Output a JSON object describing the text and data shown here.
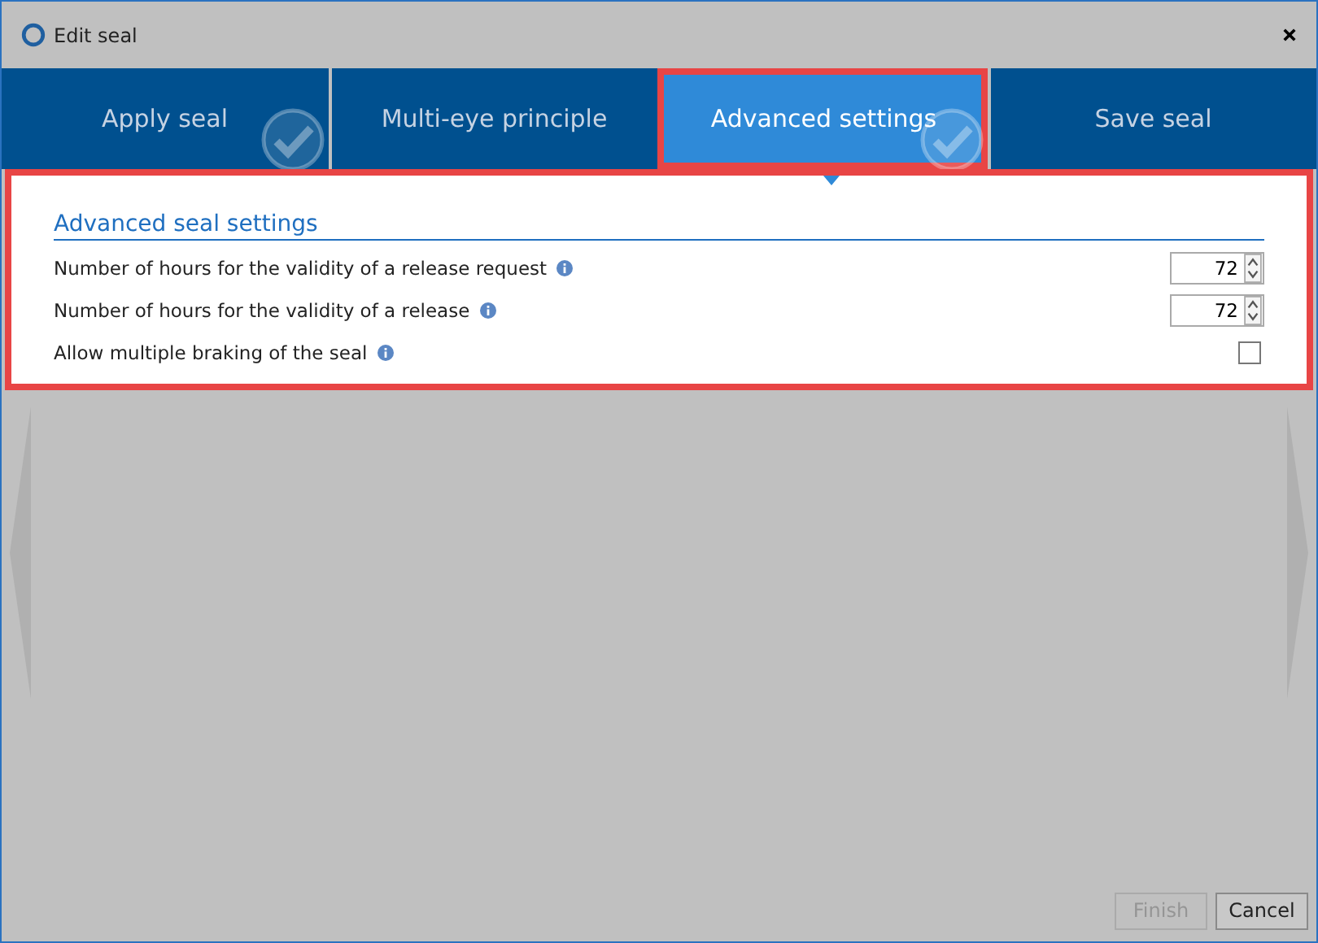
{
  "window": {
    "title": "Edit seal"
  },
  "tabs": [
    {
      "label": "Apply seal",
      "selected": false,
      "done": true
    },
    {
      "label": "Multi-eye principle",
      "selected": false,
      "done": false
    },
    {
      "label": "Advanced settings",
      "selected": true,
      "done": true
    },
    {
      "label": "Save seal",
      "selected": false,
      "done": false
    }
  ],
  "section": {
    "title": "Advanced seal settings"
  },
  "settings": [
    {
      "kind": "number",
      "label": "Number of hours for the validity of a release request",
      "value": "72"
    },
    {
      "kind": "number",
      "label": "Number of hours for the validity of a release",
      "value": "72"
    },
    {
      "kind": "checkbox",
      "label": "Allow multiple braking of the seal",
      "checked": false
    }
  ],
  "buttons": [
    {
      "label": "Finish",
      "disabled": true
    },
    {
      "label": "Cancel",
      "disabled": false
    }
  ]
}
